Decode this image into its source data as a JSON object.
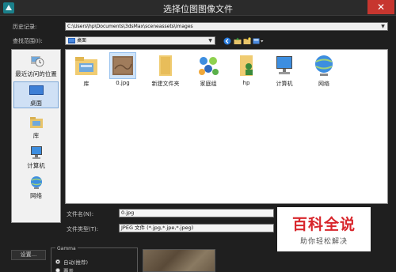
{
  "window": {
    "title": "选择位图图像文件",
    "close_glyph": "✕"
  },
  "history": {
    "label": "历史记录:",
    "value": "C:\\Users\\hp\\Documents\\3dsMax\\sceneassets\\images"
  },
  "lookin": {
    "label": "查找范围(I):",
    "value": "桌面"
  },
  "toolbar": {
    "icons": [
      "back-icon",
      "up-folder-icon",
      "new-folder-icon",
      "view-menu-icon"
    ]
  },
  "sidebar": {
    "items": [
      {
        "label": "最近访问的位置",
        "icon": "recent-places-icon"
      },
      {
        "label": "桌面",
        "icon": "desktop-icon",
        "active": true
      },
      {
        "label": "库",
        "icon": "libraries-icon"
      },
      {
        "label": "计算机",
        "icon": "computer-icon"
      },
      {
        "label": "网络",
        "icon": "network-icon"
      }
    ]
  },
  "files": [
    {
      "label": "库",
      "icon": "libraries-folder-icon"
    },
    {
      "label": "0.jpg",
      "icon": "image-thumbnail-icon",
      "selected": true
    },
    {
      "label": "新建文件夹",
      "icon": "folder-icon"
    },
    {
      "label": "家庭组",
      "icon": "homegroup-icon"
    },
    {
      "label": "hp",
      "icon": "user-folder-icon"
    },
    {
      "label": "计算机",
      "icon": "computer-icon"
    },
    {
      "label": "网络",
      "icon": "network-icon"
    }
  ],
  "filename": {
    "label": "文件名(N):",
    "value": "0.jpg"
  },
  "filetype": {
    "label": "文件类型(T):",
    "value": "JPEG 文件 (*.jpg,*.jpe,*.jpeg)"
  },
  "watermark": {
    "line1": "百科全说",
    "line2": "助你轻松解决"
  },
  "settings": {
    "button_label": "设置..."
  },
  "gamma": {
    "title": "Gamma",
    "auto_label": "自动(推荐)",
    "override_label": "覆盖"
  },
  "colors": {
    "background": "#1f1f1f",
    "close_button": "#c7362f",
    "watermark_red": "#d8262c"
  }
}
